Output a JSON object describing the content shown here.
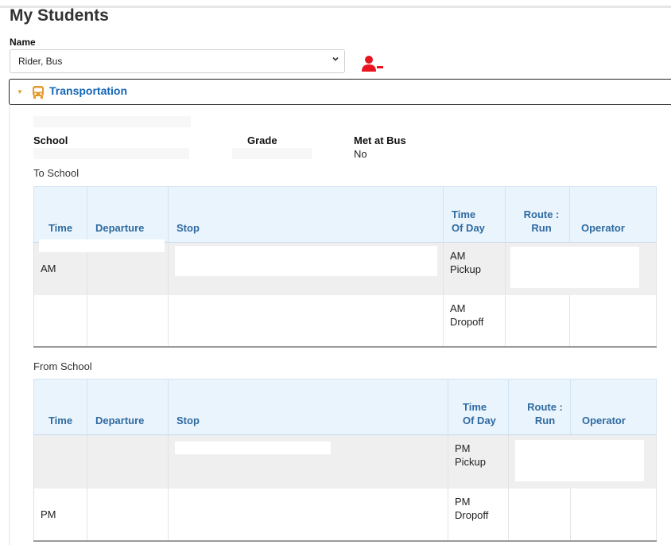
{
  "page": {
    "title": "My Students"
  },
  "student_select": {
    "label": "Name",
    "value": "Rider, Bus"
  },
  "icons": {
    "remove_user": "remove-user-icon",
    "expand": "chevron-down-icon",
    "bus": "bus-icon",
    "dropdown": "chevron-down-icon"
  },
  "colors": {
    "remove_user": "#e8141f",
    "panel_title": "#1466b8",
    "header_bg": "#eaf4fd",
    "header_text": "#2f6aa0",
    "bus_icon": "#e39a2c"
  },
  "transportation": {
    "title": "Transportation",
    "fields": {
      "school_label": "School",
      "grade_label": "Grade",
      "met_at_bus_label": "Met at Bus",
      "met_at_bus_value": "No"
    },
    "to_school": {
      "title": "To School",
      "columns": [
        "Time",
        "Departure",
        "Stop",
        "Time Of Day",
        "Route : Run",
        "Operator"
      ],
      "rows": [
        {
          "time": "AM",
          "time_of_day": "AM Pickup"
        },
        {
          "time": "",
          "time_of_day": "AM Dropoff"
        }
      ]
    },
    "from_school": {
      "title": "From School",
      "columns": [
        "Time",
        "Departure",
        "Stop",
        "Time Of Day",
        "Route : Run",
        "Operator"
      ],
      "rows": [
        {
          "time": "",
          "time_of_day": "PM Pickup"
        },
        {
          "time": "PM",
          "time_of_day": "PM Dropoff"
        }
      ]
    }
  }
}
